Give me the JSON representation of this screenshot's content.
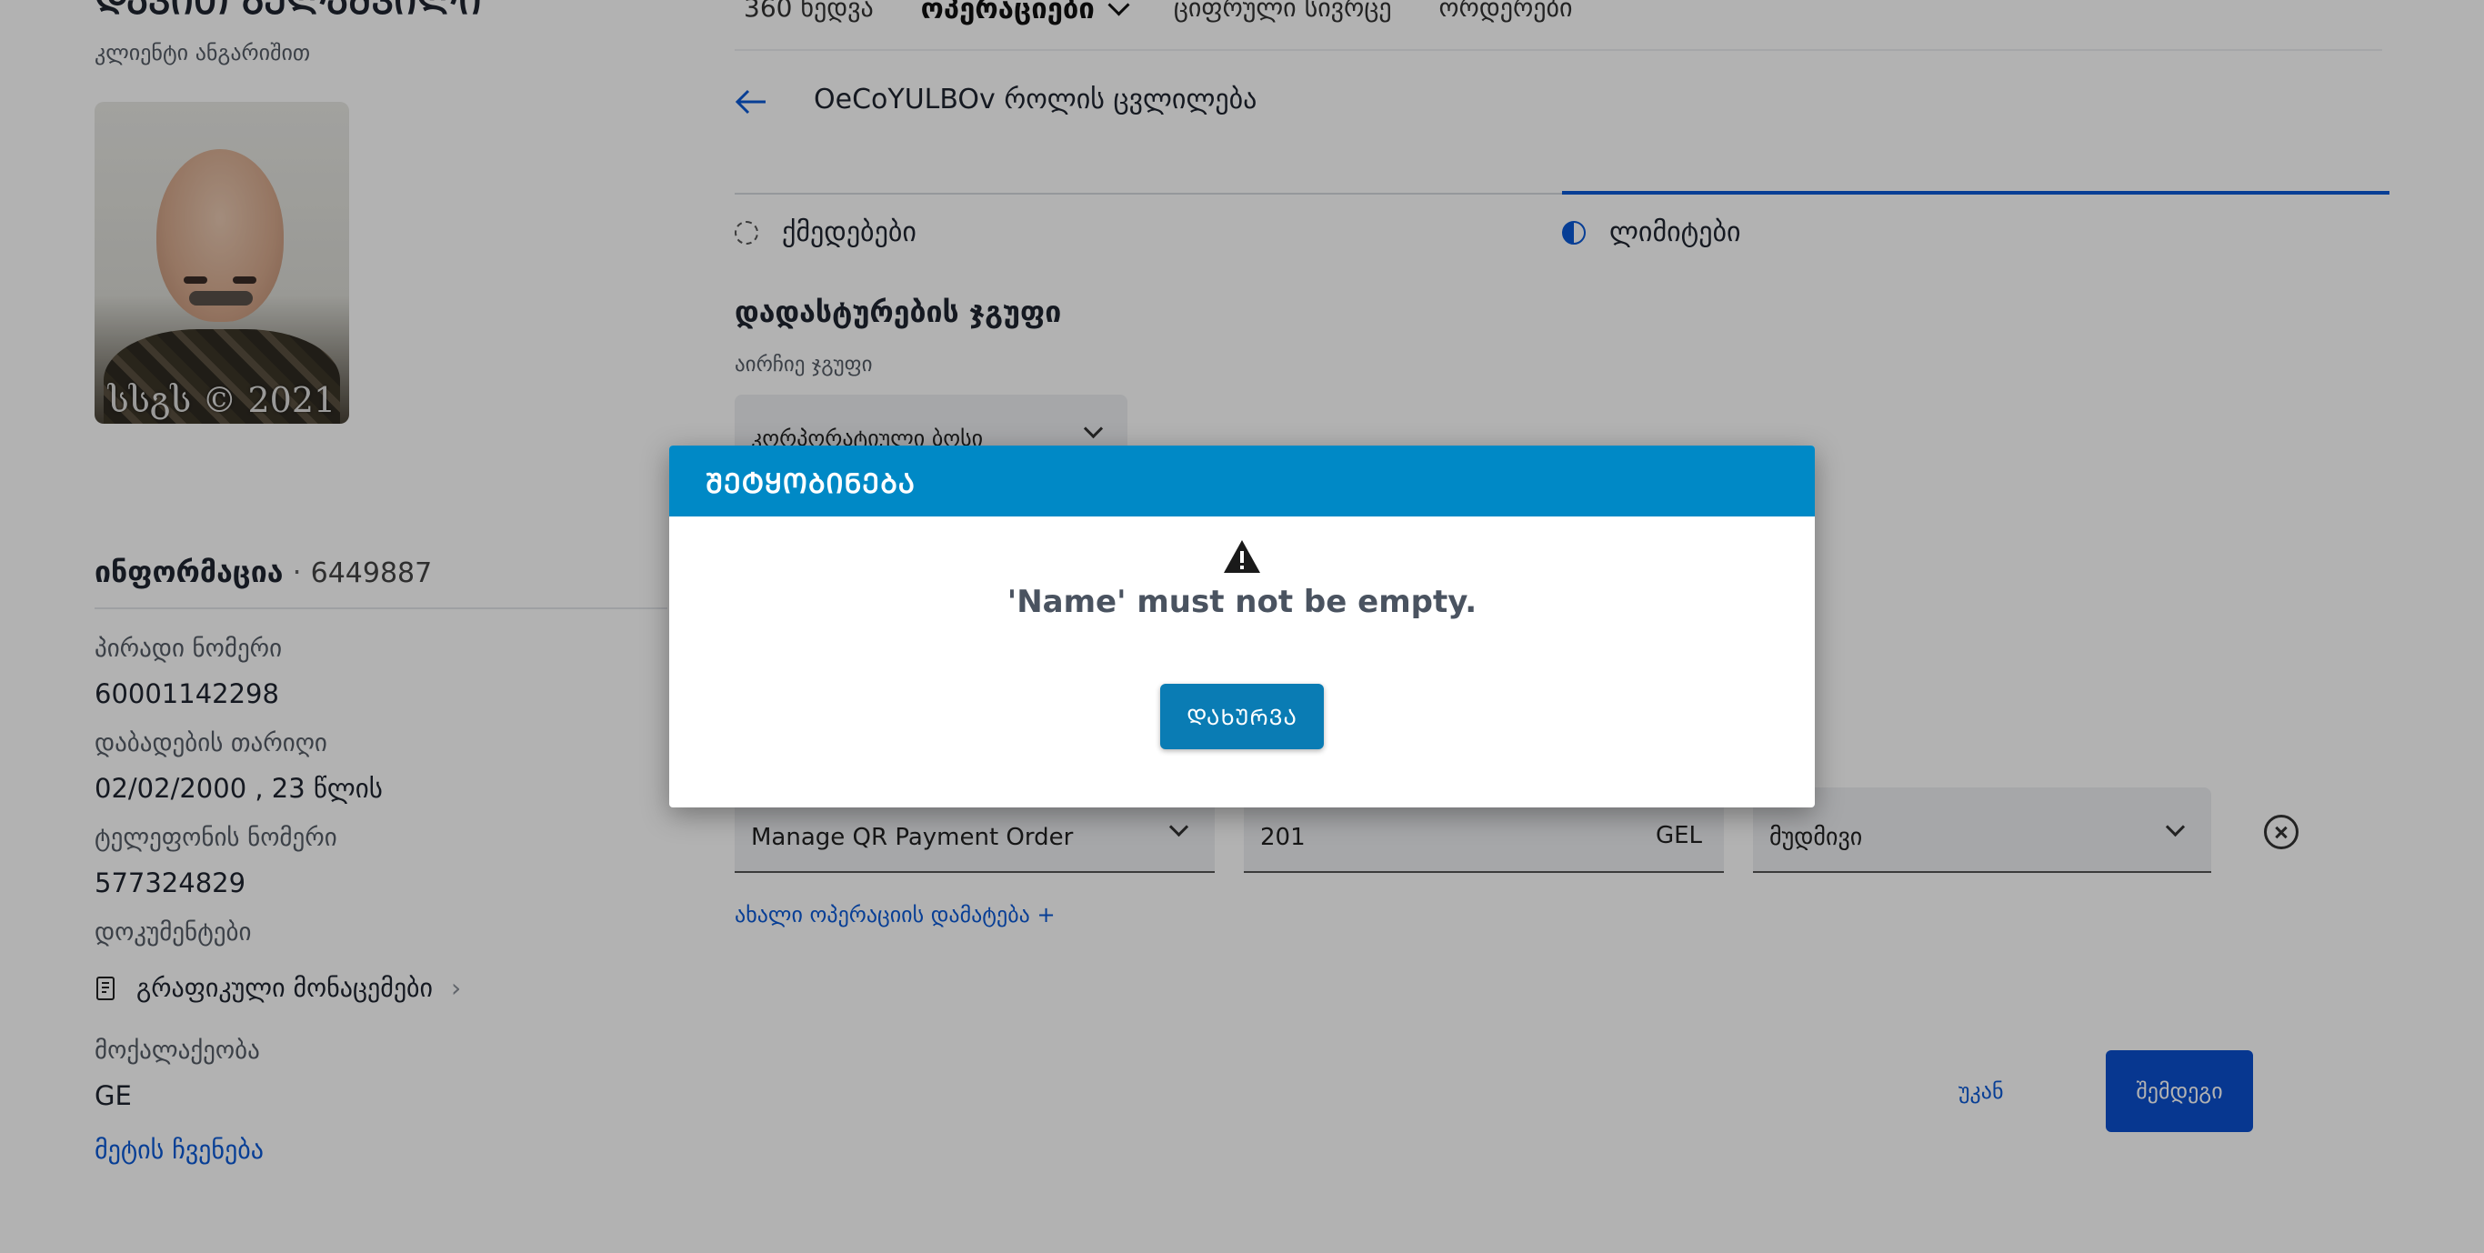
{
  "client": {
    "name": "ᲓᲐᲕᲘᲗ ᲒᲔᲚᲐᲨᲕᲘᲚᲘ",
    "subtitle": "კლიენტი ანგარიშით",
    "photo_watermark": "სსგს © 2021"
  },
  "info": {
    "heading": "ინფორმაცია",
    "separator": "·",
    "id_number": "6449887",
    "fields": [
      {
        "label": "პირადი ნომერი",
        "value": "60001142298"
      },
      {
        "label": "დაბადების თარიღი",
        "value": "02/02/2000 , 23 წლის"
      },
      {
        "label": "ტელეფონის ნომერი",
        "value": "577324829"
      }
    ],
    "documents_label": "დოკუმენტები",
    "documents_link": "გრაფიკული მონაცემები",
    "citizenship_label": "მოქალაქეობა",
    "citizenship_value": "GE",
    "show_more": "მეტის ჩვენება"
  },
  "nav": {
    "items": [
      "360 ხედვა",
      "ოპერაციები",
      "ციფრული სივრცე",
      "ორდერები"
    ],
    "active_index": 1
  },
  "edit": {
    "title": "OeCoYULBOv როლის ცვლილება",
    "tabs": [
      {
        "label": "ქმედებები",
        "state": "pending"
      },
      {
        "label": "ლიმიტები",
        "state": "active"
      }
    ],
    "group_title": "დადასტურების ჯგუფი",
    "group_sublabel": "აირჩიე ჯგუფი",
    "group_select_value": "კორპორატიული ბოსი",
    "operation": {
      "name": "Manage QR Payment Order",
      "amount": "201",
      "currency": "GEL",
      "period": "მუდმივი"
    },
    "add_operation": "ახალი ოპერაციის დამატება +",
    "back_label": "უკან",
    "next_label": "შემდეგი"
  },
  "modal": {
    "title": "ᲨᲔᲢᲧᲝᲑᲘᲜᲔᲑᲐ",
    "message": "'Name' must not be empty.",
    "close_label": "ᲓᲐᲮᲣᲠᲕᲐ",
    "icon": "warning-icon"
  },
  "colors": {
    "accent": "#0b5ad6",
    "modal_header": "#0089c6",
    "modal_button": "#0a7cb4"
  }
}
